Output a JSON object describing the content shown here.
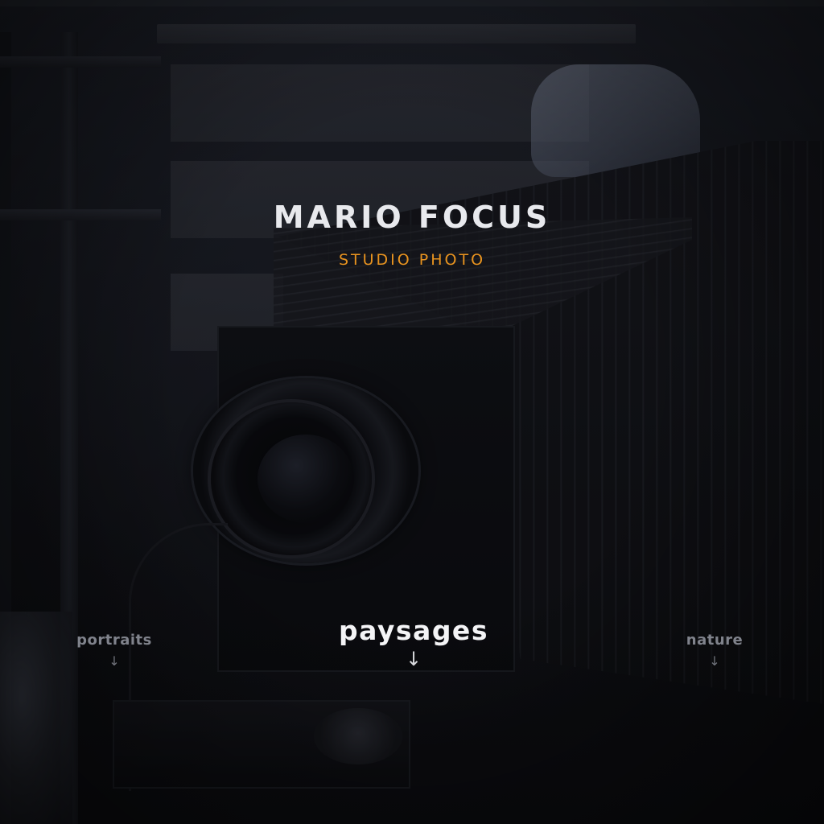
{
  "brand": {
    "title": "MARIO FOCUS",
    "subtitle": "STUDIO PHOTO",
    "subtitle_color": "#e8931f"
  },
  "nav": {
    "items": [
      {
        "label": "portraits",
        "arrow": "↓",
        "active": false
      },
      {
        "label": "paysages",
        "arrow": "↓",
        "active": true
      },
      {
        "label": "nature",
        "arrow": "↓",
        "active": false
      }
    ]
  },
  "background": {
    "subject": "large-format-camera-photo"
  }
}
